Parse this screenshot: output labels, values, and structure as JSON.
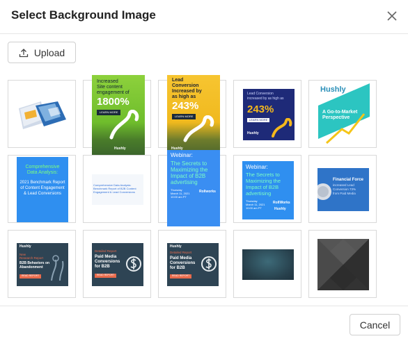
{
  "dialog": {
    "title": "Select Background Image",
    "upload_label": "Upload",
    "cancel_label": "Cancel"
  },
  "thumbnails": {
    "t2": {
      "l1": "Increased",
      "l2": "Site content",
      "l3": "engagement of",
      "big": "1800%",
      "btn": "LEARN MORE",
      "brand": "Hushly"
    },
    "t3": {
      "l1": "Lead",
      "l2": "Conversion",
      "l3": "Increased by",
      "l4": "as high as",
      "big": "243%",
      "btn": "LEARN MORE",
      "brand": "Hushly"
    },
    "t4": {
      "l1": "Lead Conversion",
      "l2": "increased by as high as",
      "big": "243%",
      "btn": "LEARN MORE",
      "brand": "Hushly"
    },
    "t5": {
      "brand": "Hushly",
      "l1": "A Go-to-Market",
      "l2": "Perspective"
    },
    "t6": {
      "l1": "Comprehensive",
      "l2": "Data Analysis:",
      "l3": "2021 Benchmark Report",
      "l4": "of Content Engagement",
      "l5": "& Lead Conversions"
    },
    "t7": {
      "l1": "Comprehensive Data Analysis:",
      "l2": "Benchmark Report of B2B Content",
      "l3": "Engagement & Lead Conversions"
    },
    "t8": {
      "l1": "Webinar:",
      "l2": "The Secrets to",
      "l3": "Maximizing the",
      "l4": "Impact of B2B",
      "l5": "advertising",
      "l6": "Thursday",
      "l7": "March 11, 2021",
      "l8": "10:00 am PT",
      "brand": "Rollworks"
    },
    "t9": {
      "l1": "Webinar:",
      "l2": "The Secrets to",
      "l3": "Maximizing the",
      "l4": "Impact of B2B",
      "l5": "advertising",
      "l6": "Thursday",
      "l7": "March 11, 2021",
      "l8": "10:00 am PT",
      "brand1": "RollWorks",
      "brand2": "Hushly"
    },
    "t10": {
      "l1": "Financial Force",
      "l2": "increased Lead",
      "l3": "Conversion 73%",
      "l4": "from Paid Media"
    },
    "t11": {
      "brand": "Hushly",
      "l1": "New",
      "l2": "Research Report",
      "l3": "B2B Behaviors on",
      "l4": "Abandonment",
      "btn": "READ REPORT"
    },
    "t12": {
      "l1": "Detailed Report",
      "l2": "Paid Media",
      "l3": "Conversions",
      "l4": "for B2B",
      "btn": "READ REPORT"
    },
    "t13": {
      "brand": "Hushly",
      "l1": "Detailed Report",
      "l2": "Paid Media",
      "l3": "Conversions",
      "l4": "for B2B",
      "btn": "READ REPORT"
    }
  }
}
